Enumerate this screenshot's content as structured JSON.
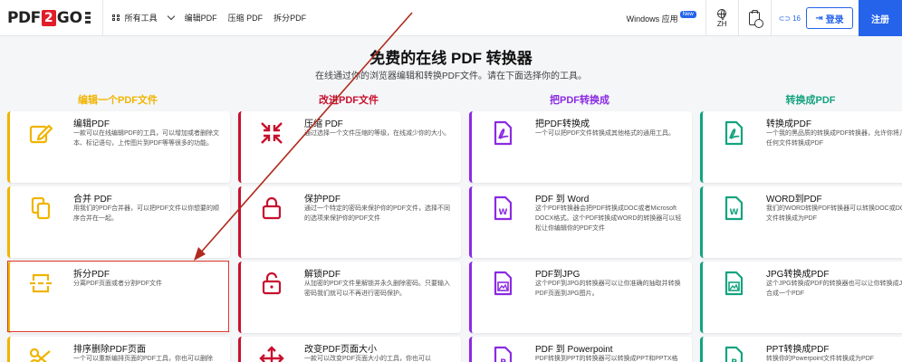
{
  "header": {
    "logo": {
      "left": "PDF",
      "mid": "2",
      "right": "GO"
    },
    "all_tools": "所有工具",
    "nav": [
      "编辑PDF",
      "压缩 PDF",
      "拆分PDF"
    ],
    "windows_app": "Windows 应用",
    "new_badge": "New",
    "lang": "ZH",
    "credits": "16",
    "login": "登录",
    "register": "注册"
  },
  "hero": {
    "title": "免费的在线 PDF 转换器",
    "subtitle": "在线通过你的浏览器编辑和转换PDF文件。请在下面选择你的工具。"
  },
  "columns": [
    {
      "heading": "编辑一个PDF文件",
      "color": "#f0b400"
    },
    {
      "heading": "改进PDF文件",
      "color": "#c8102e"
    },
    {
      "heading": "把PDF转换成",
      "color": "#8a2be2"
    },
    {
      "heading": "转换成PDF",
      "color": "#14a37f"
    }
  ],
  "cards": {
    "c0": [
      {
        "title": "编辑PDF",
        "desc": "一款可以在线编辑PDF的工具，可以增加或者删除文本、标记语句，上传图片到PDF等等很多的功能。",
        "icon": "pencil-icon"
      },
      {
        "title": "合并 PDF",
        "desc": "用我们的PDF合并器，可以把PDF文件以你想要的顺序合并在一起。",
        "icon": "merge-icon"
      },
      {
        "title": "拆分PDF",
        "desc": "分离PDF页面或者分割PDF文件",
        "icon": "split-icon"
      },
      {
        "title": "排序删除PDF页面",
        "desc": "一个可以重新编排页面的PDF工具，你也可以删除",
        "icon": "scissors-icon"
      }
    ],
    "c1": [
      {
        "title": "压缩 PDF",
        "desc": "通过选择一个文件压缩的等级，在线减少你的大小。",
        "icon": "compress-icon"
      },
      {
        "title": "保护PDF",
        "desc": "通过一个特定的密码来保护你的PDF文件，选择不同的选项来保护你的PDF文件",
        "icon": "lock-icon"
      },
      {
        "title": "解锁PDF",
        "desc": "从加密的PDF文件里解锁并永久删除密码。只要输入密码我们就可以不再进行密码保护。",
        "icon": "unlock-icon"
      },
      {
        "title": "改变PDF页面大小",
        "desc": "一款可以改变PDF页面大小的工具，你也可以",
        "icon": "resize-icon"
      }
    ],
    "c2": [
      {
        "title": "把PDF转换成",
        "desc": "一个可以把PDF文件转换成其他格式的通用工具。",
        "icon": "pdf-file-icon"
      },
      {
        "title": "PDF 到 Word",
        "desc": "这个PDF转换器会把PDF转换成DOC或者Microsoft DOCX格式。这个PDF转换成WORD的转换器可以轻松让你编辑你的PDF文件",
        "icon": "word-file-icon"
      },
      {
        "title": "PDF到JPG",
        "desc": "这个PDF到JPG的转换器可以让你准确的抽取并转换PDF页面到JPG图片。",
        "icon": "image-file-icon"
      },
      {
        "title": "PDF 到 Powerpoint",
        "desc": "PDF转换到PPT的转换器可以转换成PPT和PPTX格式",
        "icon": "ppt-file-icon"
      }
    ],
    "c3": [
      {
        "title": "转换成PDF",
        "desc": "一个我的黑品质的转换成PDF转换器，允许你将几乎任何文件转换成PDF",
        "icon": "pdf-file-icon"
      },
      {
        "title": "WORD到PDF",
        "desc": "我们的WORD转换PDF转换器可以转换DOC或DOCX文件转换成为PDF",
        "icon": "word-file-icon"
      },
      {
        "title": "JPG转换成PDF",
        "desc": "这个JPG转换成PDF的转换器也可以让你转换成JPG合成一个PDF",
        "icon": "image-file-icon"
      },
      {
        "title": "PPT转换成PDF",
        "desc": "转换你的Powerpoint文件转换成为PDF",
        "icon": "ppt-file-icon"
      }
    ]
  }
}
